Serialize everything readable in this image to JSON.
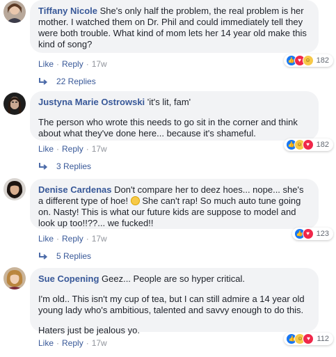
{
  "colors": {
    "link": "#385898",
    "meta": "#90949c",
    "bubble": "#f2f3f5",
    "text": "#1d2129",
    "like": "#1877f2",
    "love": "#f0284a",
    "haha": "#f7c948"
  },
  "comments": [
    {
      "author": "Tiffany Nicole",
      "paragraphs": [
        "She's only half the problem, the real problem is her mother. I watched them on Dr. Phil and could immediately tell they were both trouble. What kind of mom lets her 14 year old make this kind of song?"
      ],
      "actions": {
        "like": "Like",
        "reply": "Reply",
        "time": "17w"
      },
      "reactions": {
        "icons": [
          "like-icon",
          "love-icon",
          "haha-icon"
        ],
        "count": "182"
      },
      "replies": "22 Replies"
    },
    {
      "author": "Justyna Marie Ostrowski",
      "paragraphs": [
        "'it's lit, fam'",
        "The person who wrote this needs to go sit in the corner and think about what they've done here... because it's shameful."
      ],
      "actions": {
        "like": "Like",
        "reply": "Reply",
        "time": "17w"
      },
      "reactions": {
        "icons": [
          "like-icon",
          "haha-icon",
          "love-icon"
        ],
        "count": "182"
      },
      "replies": "3 Replies"
    },
    {
      "author": "Denise Cardenas",
      "paragraphs": [
        "Don't compare her to deez hoes... nope... she's a different type of hoe!",
        "She can't rap! So much auto tune going on. Nasty! This is what our future kids are suppose to model and look up too!!??... we fucked!!"
      ],
      "actions": {
        "like": "Like",
        "reply": "Reply",
        "time": "17w"
      },
      "reactions": {
        "icons": [
          "like-icon",
          "love-icon"
        ],
        "count": "123"
      },
      "replies": "5 Replies"
    },
    {
      "author": "Sue Copening",
      "paragraphs": [
        "Geez... People are so hyper critical.",
        "I'm old.. This isn't my cup of tea, but I can still admire a 14 year old young lady who's ambitious, talented and savvy enough to do this.",
        "Haters just be jealous yo."
      ],
      "actions": {
        "like": "Like",
        "reply": "Reply",
        "time": "17w"
      },
      "reactions": {
        "icons": [
          "like-icon",
          "haha-icon",
          "love-icon"
        ],
        "count": "112"
      }
    }
  ]
}
